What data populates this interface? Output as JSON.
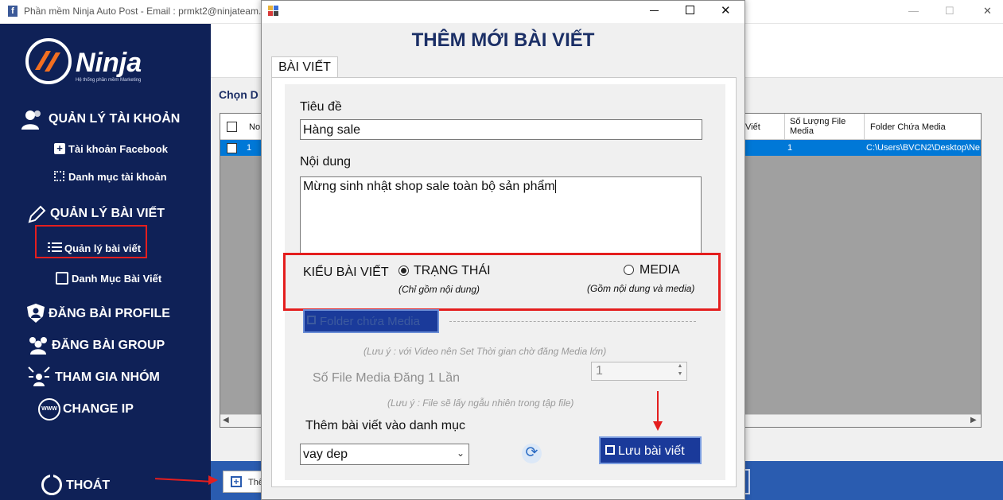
{
  "main_window": {
    "title": "Phần mềm Ninja Auto Post - Email : prmkt2@ninjateam.",
    "minimize_glyph": "—",
    "maximize_glyph": "☐",
    "close_glyph": "✕"
  },
  "brand": {
    "logo_text": "Ninja",
    "logo_subtitle": "Hệ thống phần mềm Marketing"
  },
  "sidebar": {
    "sections": [
      {
        "label": "QUẢN LÝ TÀI KHOẢN",
        "icon": "users-icon"
      },
      {
        "label": "QUẢN LÝ BÀI VIẾT",
        "icon": "edit-icon"
      },
      {
        "label": "ĐĂNG BÀI PROFILE",
        "icon": "shield-user-icon"
      },
      {
        "label": "ĐĂNG BÀI GROUP",
        "icon": "group-icon"
      },
      {
        "label": "THAM GIA NHÓM",
        "icon": "join-group-icon"
      },
      {
        "label": "CHANGE IP",
        "icon": "www-icon"
      }
    ],
    "sub_items": {
      "tai_khoan_facebook": "Tài khoản Facebook",
      "danh_muc_tai_khoan": "Danh mục tài khoản",
      "quan_ly_bai_viet": "Quản lý bài viết",
      "danh_muc_bai_viet": "Danh Mục Bài Viết"
    },
    "exit": "THOÁT"
  },
  "content": {
    "choose_label": "Chọn D",
    "grid": {
      "headers": [
        "No",
        "Viết",
        "Số Lượng File Media",
        "Folder Chứa Media"
      ],
      "row": {
        "no": "1",
        "media_count": "1",
        "folder": "C:\\Users\\BVCN2\\Desktop\\Ne"
      }
    },
    "add_button": "Thê"
  },
  "dialog": {
    "heading": "THÊM MỚI BÀI VIẾT",
    "tab": "BÀI VIẾT",
    "title_label": "Tiêu đề",
    "title_value": "Hàng sale",
    "content_label": "Nội dung",
    "content_value": "Mừng sinh nhật shop sale toàn bộ sản phẩm",
    "type_label": "KIỂU BÀI VIẾT",
    "type_status": "TRẠNG THÁI",
    "type_status_note": "(Chỉ gồm nội dung)",
    "type_media": "MEDIA",
    "type_media_note": "(Gồm nội dung và media)",
    "folder_button": "Folder chứa Media",
    "video_note": "(Lưu ý : với Video nên Set Thời gian chờ đăng Media lớn)",
    "media_count_label": "Số File Media Đăng 1 Lần",
    "media_count_value": "1",
    "random_note": "(Lưu ý : File sẽ lấy ngẫu nhiên trong tập file)",
    "category_label": "Thêm bài viết vào danh mục",
    "category_value": "vay dep",
    "save_button": "Lưu bài viết",
    "selected_type": "TRẠNG THÁI"
  },
  "colors": {
    "sidebar_bg": "#0f2157",
    "accent_red": "#e41e1e",
    "button_blue": "#1a3a9a",
    "selection_blue": "#0078d7"
  }
}
